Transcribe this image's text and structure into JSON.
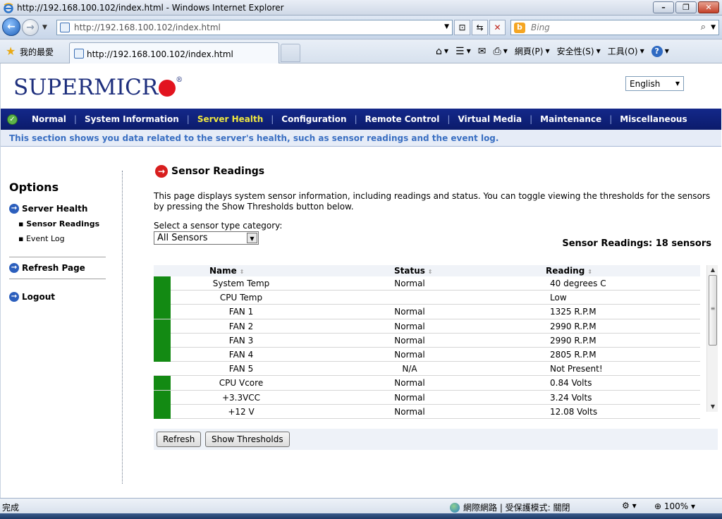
{
  "window": {
    "title": "http://192.168.100.102/index.html - Windows Internet Explorer"
  },
  "addressbar": {
    "url": "http://192.168.100.102/index.html",
    "search_placeholder": "Bing"
  },
  "favbar": {
    "favorites_label": "我的最愛",
    "tab_label": "http://192.168.100.102/index.html",
    "page_menu": "網頁(P)",
    "safety_menu": "安全性(S)",
    "tools_menu": "工具(O)"
  },
  "header": {
    "logo_text": "SUPERMICR",
    "language": "English"
  },
  "mainnav": {
    "items": [
      "Normal",
      "System Information",
      "Server Health",
      "Configuration",
      "Remote Control",
      "Virtual Media",
      "Maintenance",
      "Miscellaneous"
    ],
    "active_index": 2
  },
  "subnav": {
    "text": "This section shows you data related to the server's health, such as sensor readings and the event log."
  },
  "sidebar": {
    "title": "Options",
    "section": "Server Health",
    "subitems": [
      "Sensor Readings",
      "Event Log"
    ],
    "refresh": "Refresh Page",
    "logout": "Logout"
  },
  "main": {
    "title": "Sensor Readings",
    "description": "This page displays system sensor information, including readings and status. You can toggle viewing the thresholds for the sensors by pressing the Show Thresholds button below.",
    "category_label": "Select a sensor type category:",
    "category_value": "All Sensors",
    "count_label": "Sensor Readings: 18 sensors",
    "columns": {
      "name": "Name",
      "status": "Status",
      "reading": "Reading"
    },
    "rows": [
      {
        "name": "System Temp",
        "status": "Normal",
        "reading": "40 degrees C",
        "indicator": "#138a13"
      },
      {
        "name": "CPU Temp",
        "status": "",
        "reading": "Low",
        "indicator": "#138a13"
      },
      {
        "name": "FAN 1",
        "status": "Normal",
        "reading": "1325 R.P.M",
        "indicator": "#138a13"
      },
      {
        "name": "FAN 2",
        "status": "Normal",
        "reading": "2990 R.P.M",
        "indicator": "#138a13"
      },
      {
        "name": "FAN 3",
        "status": "Normal",
        "reading": "2990 R.P.M",
        "indicator": "#138a13"
      },
      {
        "name": "FAN 4",
        "status": "Normal",
        "reading": "2805 R.P.M",
        "indicator": "#138a13"
      },
      {
        "name": "FAN 5",
        "status": "N/A",
        "reading": "Not Present!",
        "indicator": ""
      },
      {
        "name": "CPU Vcore",
        "status": "Normal",
        "reading": "0.84 Volts",
        "indicator": "#138a13"
      },
      {
        "name": "+3.3VCC",
        "status": "Normal",
        "reading": "3.24 Volts",
        "indicator": "#138a13"
      },
      {
        "name": "+12 V",
        "status": "Normal",
        "reading": "12.08 Volts",
        "indicator": "#138a13"
      }
    ],
    "refresh_button": "Refresh",
    "thresholds_button": "Show Thresholds"
  },
  "statusbar": {
    "done": "完成",
    "zone": "網際網路 | 受保護模式: 關閉",
    "zoom": "100%"
  }
}
